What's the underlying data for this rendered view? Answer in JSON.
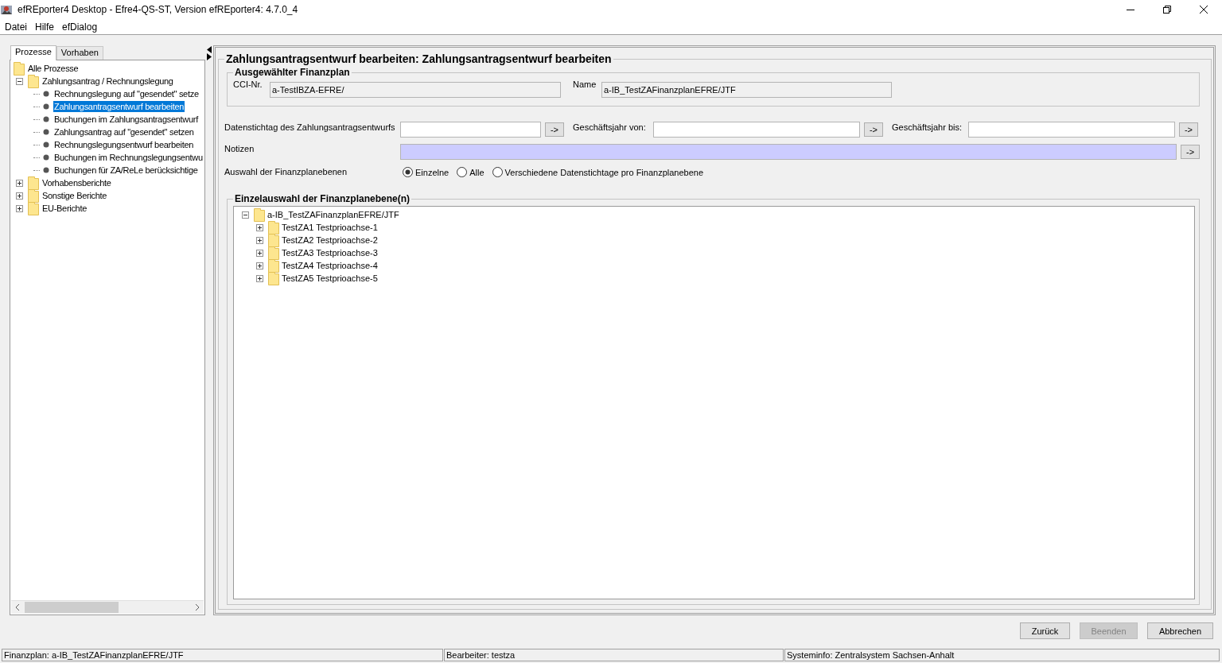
{
  "window": {
    "title": "efREporter4 Desktop - Efre4-QS-ST, Version efREporter4: 4.7.0_4"
  },
  "menu": [
    "Datei",
    "Hilfe",
    "efDialog"
  ],
  "sidebar": {
    "tabs": [
      {
        "label": "Prozesse",
        "selected": true
      },
      {
        "label": "Vorhaben",
        "selected": false
      }
    ],
    "tree": {
      "label": "Alle Prozesse",
      "children": [
        {
          "label": "Zahlungsantrag / Rechnungslegung",
          "kind": "folder",
          "expanded": true,
          "children": [
            {
              "label": "Rechnungslegung auf \"gesendet\" setze",
              "kind": "leaf",
              "selected": false
            },
            {
              "label": "Zahlungsantragsentwurf bearbeiten",
              "kind": "leaf",
              "selected": true
            },
            {
              "label": "Buchungen im Zahlungsantragsentwurf",
              "kind": "leaf",
              "selected": false
            },
            {
              "label": "Zahlungsantrag auf \"gesendet\" setzen",
              "kind": "leaf",
              "selected": false
            },
            {
              "label": "Rechnungslegungsentwurf bearbeiten",
              "kind": "leaf",
              "selected": false
            },
            {
              "label": "Buchungen im Rechnungslegungsentwu",
              "kind": "leaf",
              "selected": false
            },
            {
              "label": "Buchungen für ZA/ReLe berücksichtige",
              "kind": "leaf",
              "selected": false
            }
          ]
        },
        {
          "label": "Vorhabensberichte",
          "kind": "folder",
          "expanded": false
        },
        {
          "label": "Sonstige Berichte",
          "kind": "folder",
          "expanded": false
        },
        {
          "label": "EU-Berichte",
          "kind": "folder",
          "expanded": false
        }
      ]
    }
  },
  "form": {
    "title": "Zahlungsantragsentwurf bearbeiten: Zahlungsantragsentwurf bearbeiten",
    "plan_group": {
      "title": "Ausgewählter Finanzplan",
      "fields": [
        {
          "label": "CCI-Nr.",
          "value": "a-TestIBZA-EFRE/"
        },
        {
          "label": "Name",
          "value": "a-IB_TestZAFinanzplanEFRE/JTF"
        }
      ]
    },
    "date_fields": [
      {
        "label": "Datenstichtag des Zahlungsantragsentwurfs",
        "button": "->"
      },
      {
        "label": "Geschäftsjahr von:",
        "button": "->"
      },
      {
        "label": "Geschäftsjahr bis:",
        "button": "->"
      }
    ],
    "notes": {
      "label": "Notizen",
      "button": "->"
    },
    "level_choice": {
      "label": "Auswahl der Finanzplanebenen",
      "options": [
        {
          "label": "Einzelne",
          "selected": true
        },
        {
          "label": "Alle",
          "selected": false
        },
        {
          "label": "Verschiedene Datenstichtage pro Finanzplanebene",
          "selected": false
        }
      ]
    },
    "level_tree": {
      "title": "Einzelauswahl der Finanzplanebene(n)",
      "root": {
        "label": "a-IB_TestZAFinanzplanEFRE/JTF",
        "expanded": true,
        "children": [
          {
            "label": "TestZA1 Testprioachse-1",
            "expanded": false
          },
          {
            "label": "TestZA2 Testprioachse-2",
            "expanded": false
          },
          {
            "label": "TestZA3 Testprioachse-3",
            "expanded": false
          },
          {
            "label": "TestZA4 Testprioachse-4",
            "expanded": false
          },
          {
            "label": "TestZA5 Testprioachse-5",
            "expanded": false
          }
        ]
      }
    }
  },
  "buttons": [
    {
      "label": "Zurück",
      "disabled": false
    },
    {
      "label": "Beenden",
      "disabled": true
    },
    {
      "label": "Abbrechen",
      "disabled": false
    }
  ],
  "status_bar": [
    "Finanzplan: a-IB_TestZAFinanzplanEFRE/JTF",
    "Bearbeiter: testza",
    "Systeminfo: Zentralsystem Sachsen-Anhalt"
  ]
}
